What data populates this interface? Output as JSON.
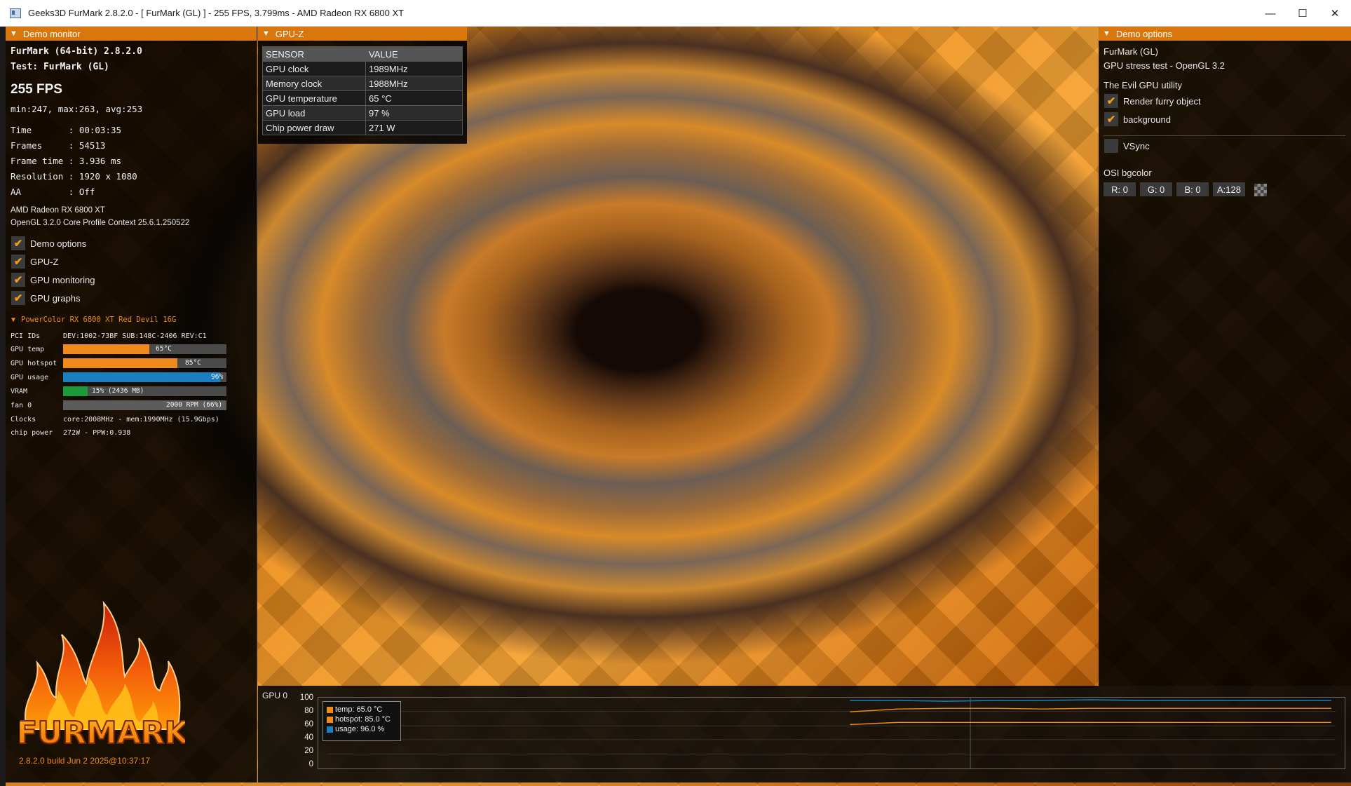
{
  "window": {
    "title": "Geeks3D FurMark 2.8.2.0 - [ FurMark (GL) ] - 255 FPS, 3.799ms - AMD Radeon RX 6800 XT",
    "controls": [
      "—",
      "☐",
      "✕"
    ]
  },
  "demo_monitor": {
    "header": "Demo monitor",
    "app_line": "FurMark (64-bit) 2.8.2.0",
    "test_line": "Test: FurMark (GL)",
    "fps": "255 FPS",
    "fps_stats": "min:247, max:263, avg:253",
    "stats": [
      "Time       : 00:03:35",
      "Frames     : 54513",
      "Frame time : 3.936 ms",
      "Resolution : 1920 x 1080",
      "AA         : Off"
    ],
    "gpu_name": "AMD Radeon RX 6800 XT",
    "gl_context": "OpenGL 3.2.0 Core Profile Context 25.6.1.250522",
    "checkboxes": [
      {
        "label": "Demo options",
        "checked": true
      },
      {
        "label": "GPU-Z",
        "checked": true
      },
      {
        "label": "GPU monitoring",
        "checked": true
      },
      {
        "label": "GPU graphs",
        "checked": true
      }
    ]
  },
  "gpu_monitoring": {
    "header": "PowerColor RX 6800 XT Red Devil 16G",
    "pci_label": "PCI IDs",
    "pci_value": "DEV:1002-73BF SUB:148C-2406 REV:C1",
    "bars": [
      {
        "label": "GPU temp",
        "text": "65°C",
        "fraction": 0.53,
        "color": "#f08a1a"
      },
      {
        "label": "GPU hotspot",
        "text": "85°C",
        "fraction": 0.7,
        "color": "#f08a1a"
      },
      {
        "label": "GPU usage",
        "text": "96%",
        "fraction": 0.96,
        "color": "#1a7fc0"
      },
      {
        "label": "VRAM",
        "text": "15% (2436 MB)",
        "fraction": 0.15,
        "color": "#1a9a3a"
      },
      {
        "label": "fan 0",
        "text": "2000 RPM (66%)",
        "fraction": 0.0,
        "color": "#777777"
      }
    ],
    "clocks_label": "Clocks",
    "clocks_value": "core:2008MHz - mem:1990MHz (15.9Gbps)",
    "power_label": "chip power",
    "power_value": "272W - PPW:0.938"
  },
  "logo": {
    "text": "FURMARK"
  },
  "build_info": "2.8.2.0 build Jun  2 2025@10:37:17",
  "gpuz": {
    "header": "GPU-Z",
    "columns": [
      "SENSOR",
      "VALUE"
    ],
    "rows": [
      [
        "GPU clock",
        "1989MHz"
      ],
      [
        "Memory clock",
        "1988MHz"
      ],
      [
        "GPU temperature",
        "65 °C"
      ],
      [
        "GPU load",
        "97 %"
      ],
      [
        "Chip power draw",
        "271 W"
      ]
    ]
  },
  "demo_options": {
    "header": "Demo options",
    "title": "FurMark (GL)",
    "subtitle": "GPU stress test - OpenGL 3.2",
    "section": "The Evil GPU utility",
    "options": [
      {
        "label": "Render furry object",
        "checked": true
      },
      {
        "label": "background",
        "checked": true
      },
      {
        "label": "VSync",
        "checked": false
      }
    ],
    "bgcolor_label": "OSI bgcolor",
    "rgba": [
      "R: 0",
      "G: 0",
      "B: 0",
      "A:128"
    ]
  },
  "gpu_graph": {
    "title": "GPU 0",
    "y_ticks": [
      "100",
      "80",
      "60",
      "40",
      "20",
      "0"
    ],
    "legend": [
      {
        "label": "temp: 65.0 °C",
        "color": "#f08a1a"
      },
      {
        "label": "hotspot: 85.0 °C",
        "color": "#f08a1a"
      },
      {
        "label": "usage: 96.0 %",
        "color": "#1a7fc0"
      }
    ],
    "chart_data": {
      "type": "line",
      "ylim": [
        0,
        100
      ],
      "series": [
        {
          "name": "temp",
          "color": "#f08a1a",
          "values": [
            62,
            65,
            65,
            65,
            65,
            65,
            65,
            65,
            65,
            65,
            65
          ]
        },
        {
          "name": "hotspot",
          "color": "#f08a1a",
          "values": [
            80,
            84,
            85,
            85,
            84,
            85,
            85,
            85,
            85,
            85,
            85
          ]
        },
        {
          "name": "usage",
          "color": "#1a7fc0",
          "values": [
            96,
            96,
            95,
            96,
            96,
            97,
            96,
            96,
            96,
            96,
            96
          ]
        }
      ]
    }
  }
}
